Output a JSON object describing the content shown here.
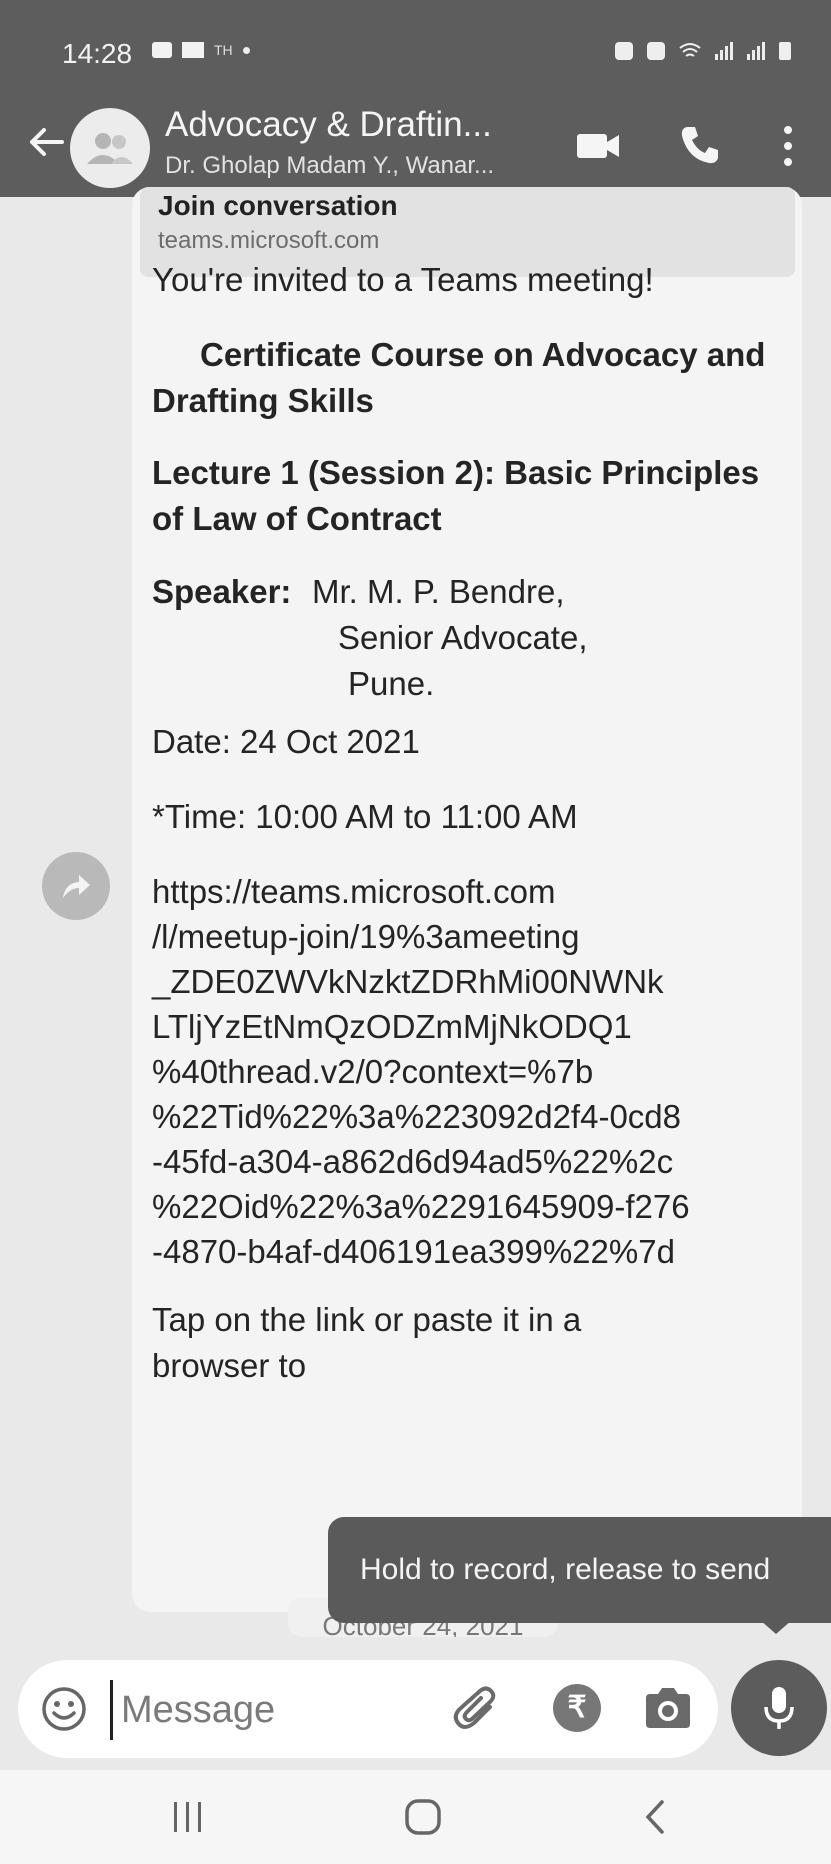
{
  "status_bar": {
    "time": "14:28",
    "extra": "TH"
  },
  "header": {
    "title": "Advocacy & Draftin...",
    "subtitle": "Dr. Gholap Madam Y., Wanar..."
  },
  "link_preview": {
    "title": "Join conversation",
    "domain": "teams.microsoft.com"
  },
  "message": {
    "intro": "You're invited to a Teams meeting!",
    "course_title": "Certificate Course on Advocacy and Drafting Skills",
    "lecture_title": "Lecture 1 (Session 2): Basic Principles of Law of Contract",
    "speaker_label": "Speaker:",
    "speaker_name": "Mr. M. P. Bendre,",
    "speaker_role": "Senior Advocate,",
    "speaker_city": "Pune.",
    "date": "Date: 24 Oct 2021",
    "time": "*Time: 10:00 AM to 11:00 AM",
    "link_lines": [
      "https://teams.microsoft.com",
      "/l/meetup-join/19%3ameeting",
      "_ZDE0ZWVkNzktZDRhMi00NWNk",
      "LTljYzEtNmQzODZmMjNkODQ1",
      "%40thread.v2/0?context=%7b",
      "%22Tid%22%3a%223092d2f4-0cd8",
      "-45fd-a304-a862d6d94ad5%22%2c",
      "%22Oid%22%3a%2291645909-f276",
      "-4870-b4af-d406191ea399%22%7d"
    ],
    "footer": "Tap on the link or paste it in a browser to"
  },
  "date_chip": "October 24, 2021",
  "tooltip": "Hold to record, release to send",
  "composer": {
    "placeholder": "Message",
    "rupee_symbol": "₹"
  },
  "icons": {
    "back": "back-arrow-icon",
    "avatar": "group-avatar-icon",
    "video": "video-call-icon",
    "call": "phone-icon",
    "more": "more-vert-icon",
    "forward": "forward-icon",
    "emoji": "emoji-icon",
    "attach": "paperclip-icon",
    "payment": "rupee-icon",
    "camera": "camera-icon",
    "mic": "mic-icon"
  },
  "colors": {
    "appbar": "#5d5d5d",
    "bubble": "#f4f4f4",
    "chat_background": "#e9e9e9",
    "mic_button": "#5c5c5c"
  }
}
